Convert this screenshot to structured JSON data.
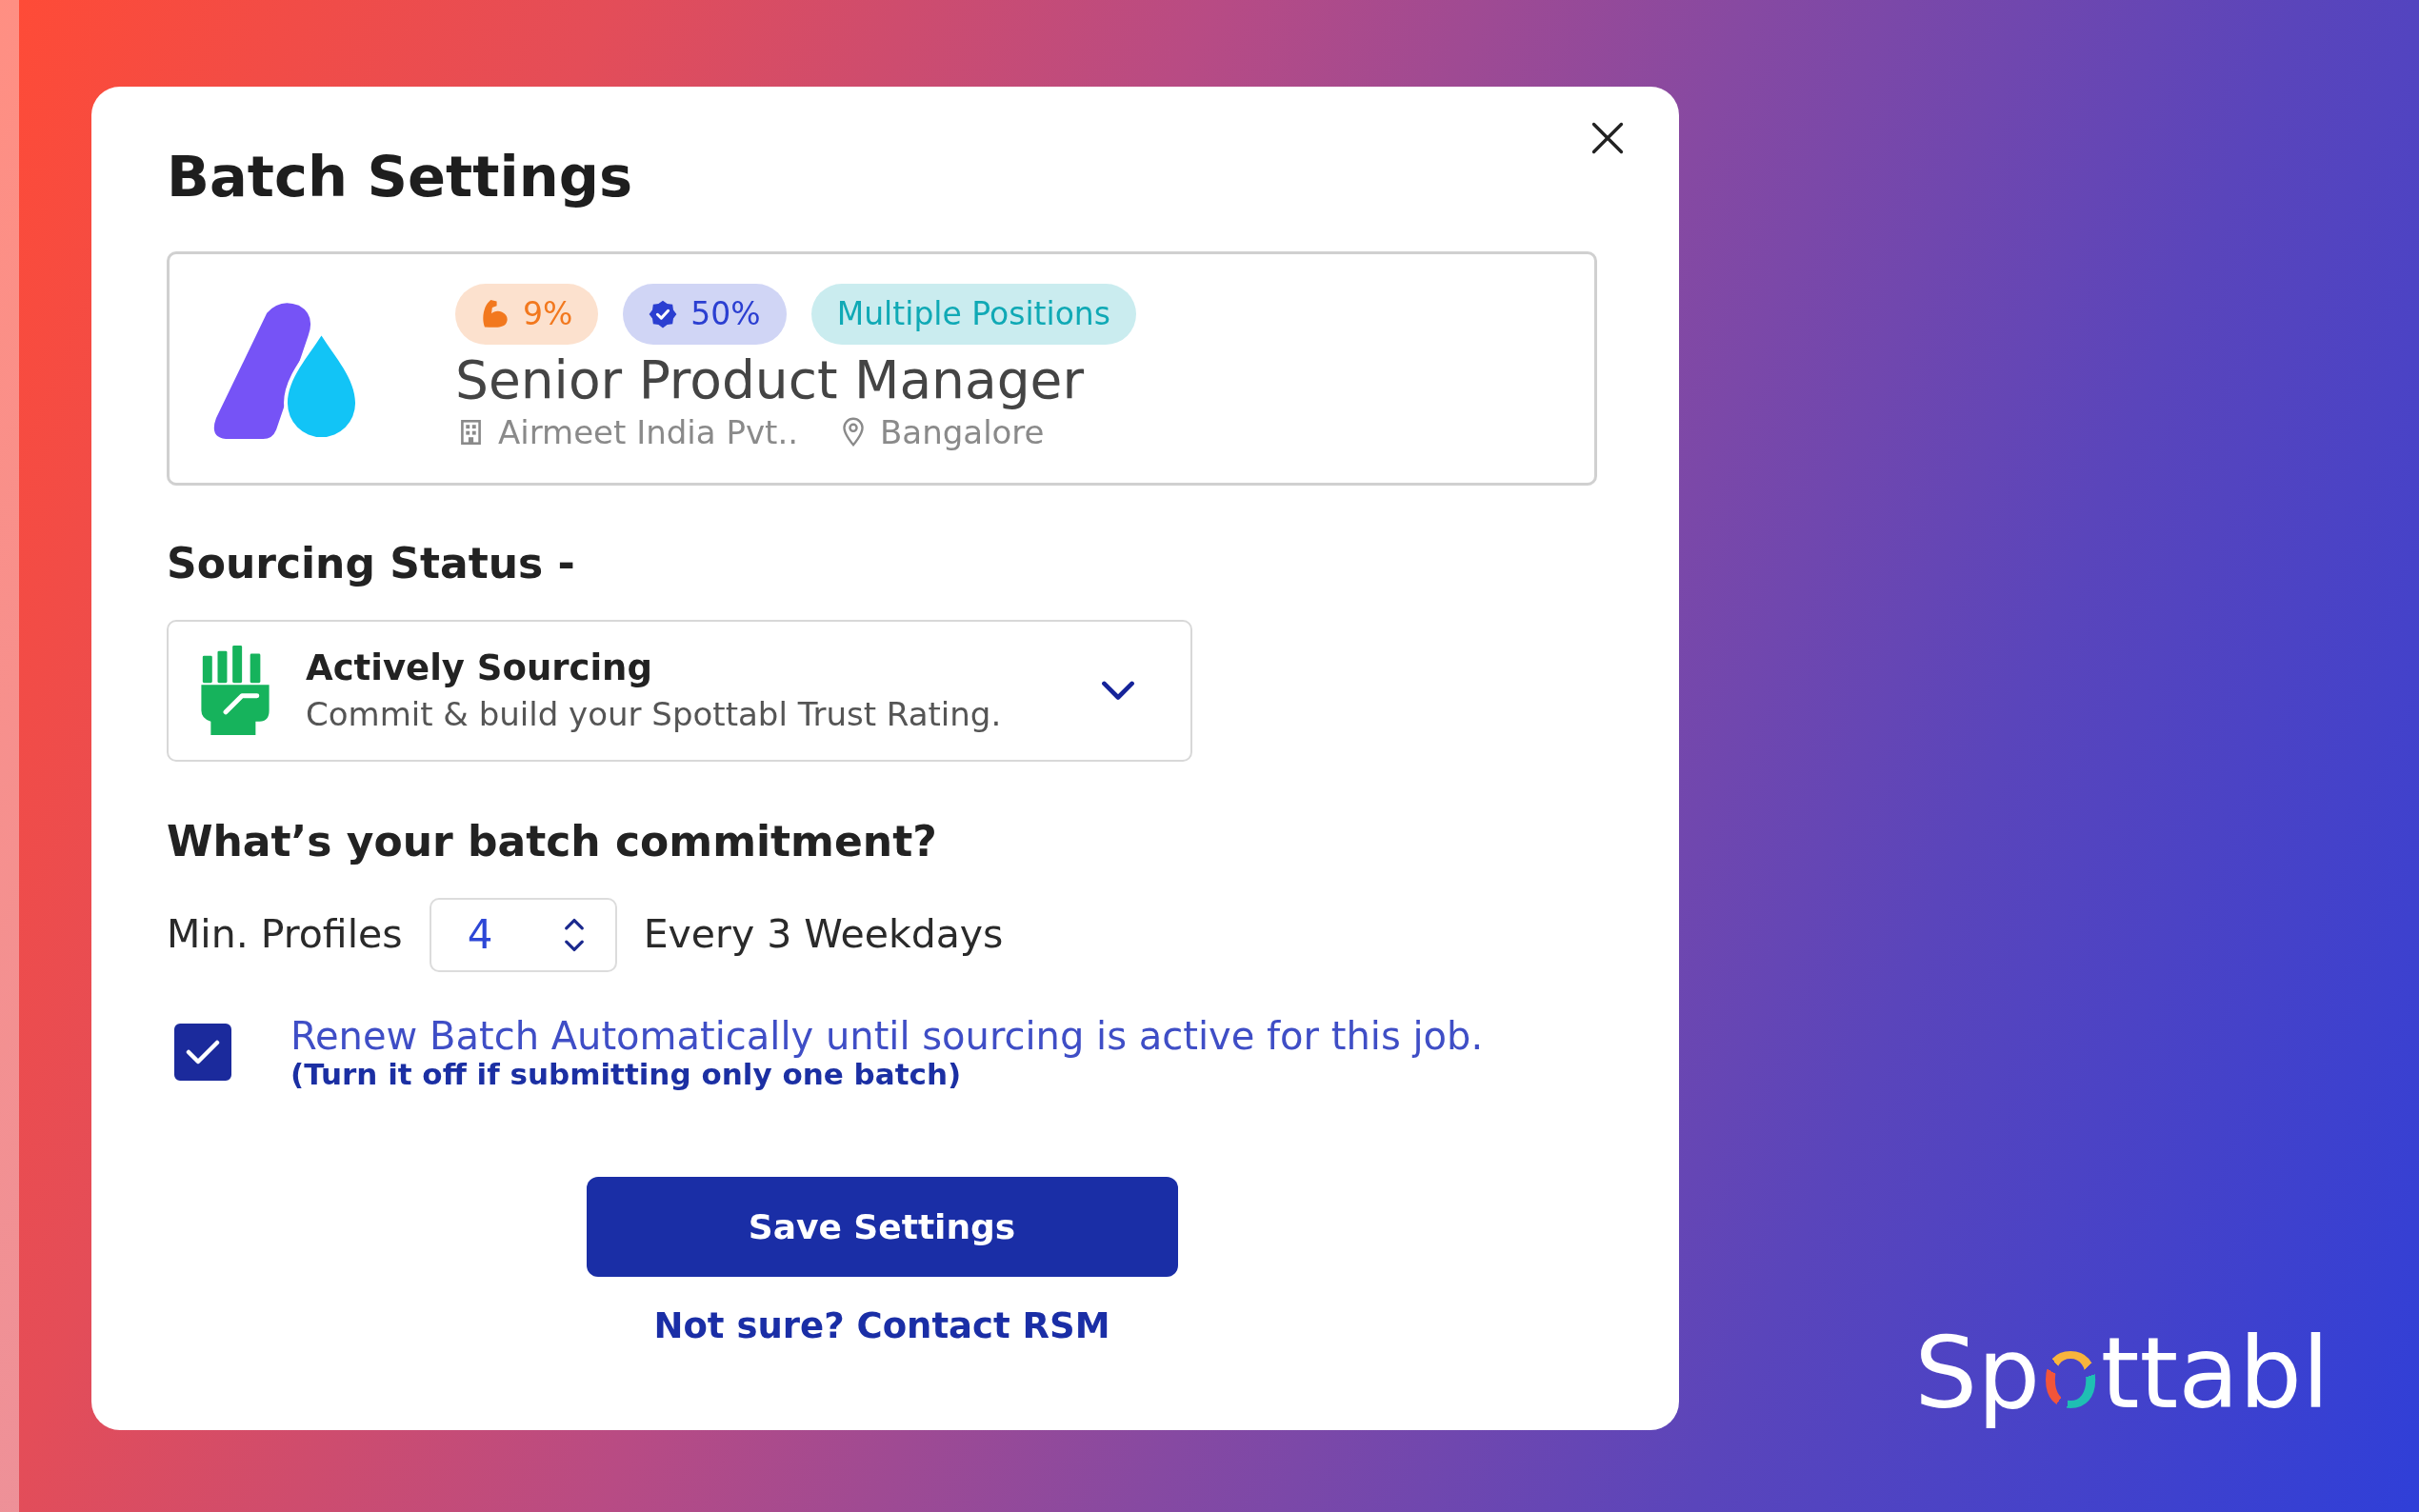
{
  "dialog": {
    "title": "Batch Settings"
  },
  "job": {
    "badges": [
      {
        "kind": "boost",
        "text": "9%",
        "color": "#f2781e"
      },
      {
        "kind": "verified",
        "text": "50%",
        "color": "#2b3fd1"
      },
      {
        "kind": "plain",
        "text": "Multiple Positions",
        "color": "#10a9b5"
      }
    ],
    "title": "Senior Product Manager",
    "company": "Airmeet India Pvt..",
    "location": "Bangalore"
  },
  "sourcing": {
    "heading": "Sourcing Status -",
    "selected_option": {
      "title": "Actively Sourcing",
      "description": "Commit & build your Spottabl Trust Rating."
    }
  },
  "commitment": {
    "heading": "What’s your batch commitment?",
    "min_label": "Min. Profiles",
    "min_value": "4",
    "interval_label": "Every 3 Weekdays"
  },
  "auto_renew": {
    "checked": true,
    "label": "Renew Batch Automatically until sourcing is active for this job.",
    "hint": "(Turn it off if submitting only one batch)"
  },
  "actions": {
    "primary": "Save Settings",
    "link": "Not sure? Contact RSM"
  },
  "brand": {
    "parts": [
      {
        "kind": "plain",
        "text": "Sp"
      },
      {
        "kind": "ring",
        "text": "o"
      },
      {
        "kind": "plain",
        "text": "ttabl"
      }
    ]
  }
}
